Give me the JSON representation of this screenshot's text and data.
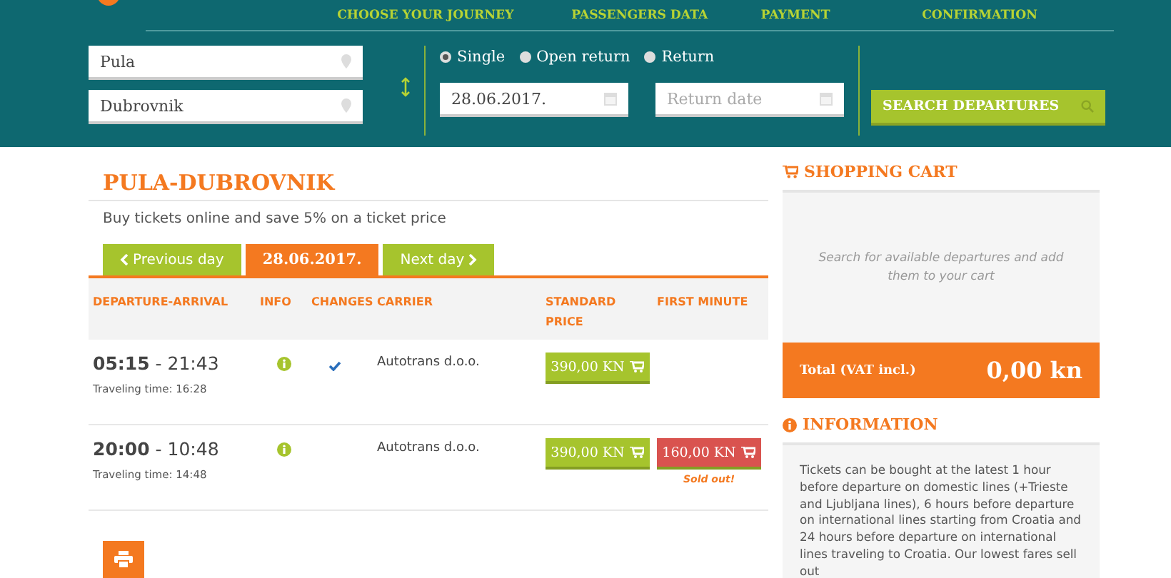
{
  "steps": [
    {
      "label": "CHOOSE YOUR JOURNEY"
    },
    {
      "label": "PASSENGERS DATA"
    },
    {
      "label": "PAYMENT"
    },
    {
      "label": "CONFIRMATION"
    }
  ],
  "search": {
    "from": "Pula",
    "to": "Dubrovnik",
    "trip_types": [
      {
        "label": "Single",
        "selected": true
      },
      {
        "label": "Open return",
        "selected": false
      },
      {
        "label": "Return",
        "selected": false
      }
    ],
    "date": "28.06.2017.",
    "return_placeholder": "Return date",
    "button": "SEARCH DEPARTURES"
  },
  "route": {
    "title": "PULA-DUBROVNIK",
    "subtitle": "Buy tickets online and save 5% on a ticket price"
  },
  "day_tabs": [
    {
      "label": "Previous day",
      "kind": "prev",
      "selected": false
    },
    {
      "label": "28.06.2017.",
      "kind": "date",
      "selected": true
    },
    {
      "label": "Next day",
      "kind": "next",
      "selected": false
    }
  ],
  "table": {
    "columns": [
      "DEPARTURE-ARRIVAL",
      "INFO",
      "CHANGES",
      "CARRIER",
      "STANDARD PRICE",
      "FIRST MINUTE"
    ],
    "rows": [
      {
        "times": "**05:15** - 21:43",
        "travel_time": "Traveling time: 16:28",
        "changes": true,
        "carrier": "Autotrans d.o.o.",
        "standard_price": "390,00 KN"
      },
      {
        "times": "**20:00** - 10:48",
        "travel_time": "Traveling time: 14:48",
        "changes": false,
        "carrier": "Autotrans d.o.o.",
        "standard_price": "390,00 KN",
        "first_minute": {
          "price": "160,00 KN",
          "note": "Sold out!"
        }
      }
    ]
  },
  "cart": {
    "title": "SHOPPING CART",
    "empty_text": "Search for available departures and add them to your cart",
    "total_label": "Total (VAT incl.)",
    "total_value": "0,00 kn"
  },
  "information": {
    "title": "INFORMATION",
    "text": "Tickets can be bought at the latest 1 hour before departure on domestic lines (+Trieste and Ljubljana lines), 6 hours before departure on international lines starting from Croatia and 24 hours before departure on international lines traveling to Croatia. Our lowest fares sell out"
  }
}
